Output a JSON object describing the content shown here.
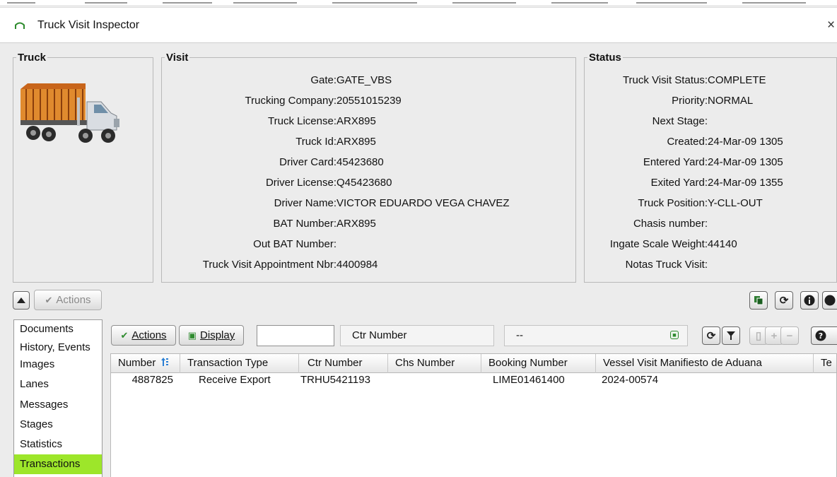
{
  "window": {
    "title": "Truck Visit Inspector",
    "close": "×"
  },
  "truck": {
    "legend": "Truck"
  },
  "visit": {
    "legend": "Visit",
    "fields": [
      {
        "label": "Gate:",
        "value": "GATE_VBS"
      },
      {
        "label": "Trucking Company:",
        "value": "20551015239"
      },
      {
        "label": "Truck License:",
        "value": "ARX895"
      },
      {
        "label": "Truck Id:",
        "value": "ARX895"
      },
      {
        "label": "Driver Card:",
        "value": "45423680"
      },
      {
        "label": "Driver License:",
        "value": "Q45423680"
      },
      {
        "label": "Driver Name:",
        "value": "VICTOR EDUARDO VEGA CHAVEZ"
      },
      {
        "label": "BAT Number:",
        "value": "ARX895"
      },
      {
        "label": "Out BAT Number:",
        "value": ""
      },
      {
        "label": "Truck Visit Appointment Nbr:",
        "value": "4400984"
      }
    ]
  },
  "status": {
    "legend": "Status",
    "fields": [
      {
        "label": "Truck Visit Status:",
        "value": "COMPLETE"
      },
      {
        "label": "Priority:",
        "value": "NORMAL"
      },
      {
        "label": "Next Stage:",
        "value": ""
      },
      {
        "label": "Created:",
        "value": "24-Mar-09 1305"
      },
      {
        "label": "Entered Yard:",
        "value": "24-Mar-09 1305"
      },
      {
        "label": "Exited Yard:",
        "value": "24-Mar-09 1355"
      },
      {
        "label": "Truck Position:",
        "value": "Y-CLL-OUT"
      },
      {
        "label": "Chasis number:",
        "value": ""
      },
      {
        "label": "Ingate Scale Weight:",
        "value": "44140"
      },
      {
        "label": "Notas Truck Visit:",
        "value": ""
      }
    ]
  },
  "toolbar": {
    "actions_label": "Actions"
  },
  "sidebar": {
    "items": [
      "Documents",
      "History, Events",
      "Images",
      "Lanes",
      "Messages",
      "Stages",
      "Statistics",
      "Transactions"
    ],
    "selected": "Transactions"
  },
  "transactions": {
    "actions_label": "Actions",
    "display_label": "Display",
    "filter_value": "",
    "filter_field": "Ctr Number",
    "filter_option": "--",
    "columns": [
      "Number",
      "Transaction Type",
      "Ctr Number",
      "Chs Number",
      "Booking Number",
      "Vessel Visit Manifiesto de Aduana",
      "Te"
    ],
    "rows": [
      [
        "4887825",
        "Receive Export",
        "TRHU5421193",
        "",
        "LIME01461400",
        "2024-00574",
        ""
      ]
    ]
  },
  "colors": {
    "selected_green": "#9de62a",
    "panel_gray": "#ececec",
    "icon_green": "#2e8b2e"
  }
}
